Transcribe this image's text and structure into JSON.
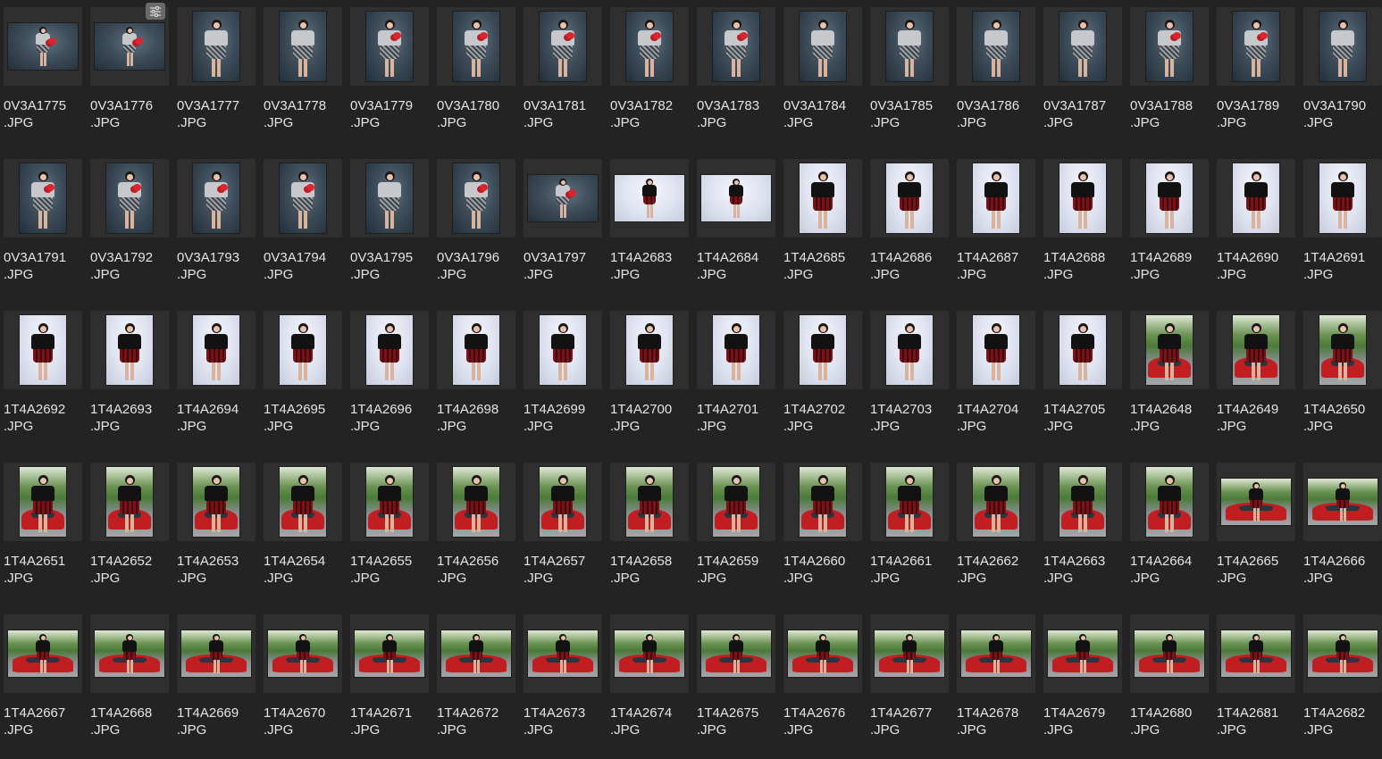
{
  "window": {
    "background": "#232323",
    "label_color": "#e4e4e4"
  },
  "badge": {
    "icon": "adjustments-sliders-icon"
  },
  "grid": {
    "columns": 16,
    "items": [
      {
        "name": "0V3A1775",
        "ext": ".JPG",
        "orient": "landscape",
        "scene": "studio-dark",
        "outfit": "grey-sequin",
        "prop": true
      },
      {
        "name": "0V3A1776",
        "ext": ".JPG",
        "orient": "landscape",
        "scene": "studio-dark",
        "outfit": "grey-sequin",
        "prop": true,
        "edited": true
      },
      {
        "name": "0V3A1777",
        "ext": ".JPG",
        "orient": "portrait",
        "scene": "studio-dark",
        "outfit": "grey-sequin"
      },
      {
        "name": "0V3A1778",
        "ext": ".JPG",
        "orient": "portrait",
        "scene": "studio-dark",
        "outfit": "grey-sequin"
      },
      {
        "name": "0V3A1779",
        "ext": ".JPG",
        "orient": "portrait",
        "scene": "studio-dark",
        "outfit": "grey-sequin",
        "prop": true
      },
      {
        "name": "0V3A1780",
        "ext": ".JPG",
        "orient": "portrait",
        "scene": "studio-dark",
        "outfit": "grey-sequin",
        "prop": true
      },
      {
        "name": "0V3A1781",
        "ext": ".JPG",
        "orient": "portrait",
        "scene": "studio-dark",
        "outfit": "grey-sequin",
        "prop": true
      },
      {
        "name": "0V3A1782",
        "ext": ".JPG",
        "orient": "portrait",
        "scene": "studio-dark",
        "outfit": "grey-sequin",
        "prop": true
      },
      {
        "name": "0V3A1783",
        "ext": ".JPG",
        "orient": "portrait",
        "scene": "studio-dark",
        "outfit": "grey-sequin",
        "prop": true
      },
      {
        "name": "0V3A1784",
        "ext": ".JPG",
        "orient": "portrait",
        "scene": "studio-dark",
        "outfit": "grey-sequin"
      },
      {
        "name": "0V3A1785",
        "ext": ".JPG",
        "orient": "portrait",
        "scene": "studio-dark",
        "outfit": "grey-sequin"
      },
      {
        "name": "0V3A1786",
        "ext": ".JPG",
        "orient": "portrait",
        "scene": "studio-dark",
        "outfit": "grey-sequin"
      },
      {
        "name": "0V3A1787",
        "ext": ".JPG",
        "orient": "portrait",
        "scene": "studio-dark",
        "outfit": "grey-sequin"
      },
      {
        "name": "0V3A1788",
        "ext": ".JPG",
        "orient": "portrait",
        "scene": "studio-dark",
        "outfit": "grey-sequin",
        "prop": true
      },
      {
        "name": "0V3A1789",
        "ext": ".JPG",
        "orient": "portrait",
        "scene": "studio-dark",
        "outfit": "grey-sequin",
        "prop": true
      },
      {
        "name": "0V3A1790",
        "ext": ".JPG",
        "orient": "portrait",
        "scene": "studio-dark",
        "outfit": "grey-sequin"
      },
      {
        "name": "0V3A1791",
        "ext": ".JPG",
        "orient": "portrait",
        "scene": "studio-dark",
        "outfit": "grey-sequin",
        "prop": true
      },
      {
        "name": "0V3A1792",
        "ext": ".JPG",
        "orient": "portrait",
        "scene": "studio-dark",
        "outfit": "grey-sequin",
        "prop": true
      },
      {
        "name": "0V3A1793",
        "ext": ".JPG",
        "orient": "portrait",
        "scene": "studio-dark",
        "outfit": "grey-sequin",
        "prop": true
      },
      {
        "name": "0V3A1794",
        "ext": ".JPG",
        "orient": "portrait",
        "scene": "studio-dark",
        "outfit": "grey-sequin",
        "prop": true
      },
      {
        "name": "0V3A1795",
        "ext": ".JPG",
        "orient": "portrait",
        "scene": "studio-dark",
        "outfit": "grey-sequin"
      },
      {
        "name": "0V3A1796",
        "ext": ".JPG",
        "orient": "portrait",
        "scene": "studio-dark",
        "outfit": "grey-sequin",
        "prop": true
      },
      {
        "name": "0V3A1797",
        "ext": ".JPG",
        "orient": "landscape",
        "scene": "studio-dark",
        "outfit": "grey-sequin",
        "prop": true
      },
      {
        "name": "1T4A2683",
        "ext": ".JPG",
        "orient": "landscape",
        "scene": "studio-light",
        "outfit": "black-plaid"
      },
      {
        "name": "1T4A2684",
        "ext": ".JPG",
        "orient": "landscape",
        "scene": "studio-light",
        "outfit": "black-plaid"
      },
      {
        "name": "1T4A2685",
        "ext": ".JPG",
        "orient": "portrait",
        "scene": "studio-light",
        "outfit": "black-plaid"
      },
      {
        "name": "1T4A2686",
        "ext": ".JPG",
        "orient": "portrait",
        "scene": "studio-light",
        "outfit": "black-plaid"
      },
      {
        "name": "1T4A2687",
        "ext": ".JPG",
        "orient": "portrait",
        "scene": "studio-light",
        "outfit": "black-plaid"
      },
      {
        "name": "1T4A2688",
        "ext": ".JPG",
        "orient": "portrait",
        "scene": "studio-light",
        "outfit": "black-plaid"
      },
      {
        "name": "1T4A2689",
        "ext": ".JPG",
        "orient": "portrait",
        "scene": "studio-light",
        "outfit": "black-plaid"
      },
      {
        "name": "1T4A2690",
        "ext": ".JPG",
        "orient": "portrait",
        "scene": "studio-light",
        "outfit": "black-plaid"
      },
      {
        "name": "1T4A2691",
        "ext": ".JPG",
        "orient": "portrait",
        "scene": "studio-light",
        "outfit": "black-plaid"
      },
      {
        "name": "1T4A2692",
        "ext": ".JPG",
        "orient": "portrait",
        "scene": "studio-light",
        "outfit": "black-plaid"
      },
      {
        "name": "1T4A2693",
        "ext": ".JPG",
        "orient": "portrait",
        "scene": "studio-light",
        "outfit": "black-plaid"
      },
      {
        "name": "1T4A2694",
        "ext": ".JPG",
        "orient": "portrait",
        "scene": "studio-light",
        "outfit": "black-plaid"
      },
      {
        "name": "1T4A2695",
        "ext": ".JPG",
        "orient": "portrait",
        "scene": "studio-light",
        "outfit": "black-plaid"
      },
      {
        "name": "1T4A2696",
        "ext": ".JPG",
        "orient": "portrait",
        "scene": "studio-light",
        "outfit": "black-plaid"
      },
      {
        "name": "1T4A2698",
        "ext": ".JPG",
        "orient": "portrait",
        "scene": "studio-light",
        "outfit": "black-plaid"
      },
      {
        "name": "1T4A2699",
        "ext": ".JPG",
        "orient": "portrait",
        "scene": "studio-light",
        "outfit": "black-plaid"
      },
      {
        "name": "1T4A2700",
        "ext": ".JPG",
        "orient": "portrait",
        "scene": "studio-light",
        "outfit": "black-plaid"
      },
      {
        "name": "1T4A2701",
        "ext": ".JPG",
        "orient": "portrait",
        "scene": "studio-light",
        "outfit": "black-plaid"
      },
      {
        "name": "1T4A2702",
        "ext": ".JPG",
        "orient": "portrait",
        "scene": "studio-light",
        "outfit": "black-plaid"
      },
      {
        "name": "1T4A2703",
        "ext": ".JPG",
        "orient": "portrait",
        "scene": "studio-light",
        "outfit": "black-plaid"
      },
      {
        "name": "1T4A2704",
        "ext": ".JPG",
        "orient": "portrait",
        "scene": "studio-light",
        "outfit": "black-plaid"
      },
      {
        "name": "1T4A2705",
        "ext": ".JPG",
        "orient": "portrait",
        "scene": "studio-light",
        "outfit": "black-plaid"
      },
      {
        "name": "1T4A2648",
        "ext": ".JPG",
        "orient": "portrait",
        "scene": "car-outdoor",
        "outfit": "black-plaid"
      },
      {
        "name": "1T4A2649",
        "ext": ".JPG",
        "orient": "portrait",
        "scene": "car-outdoor",
        "outfit": "black-plaid"
      },
      {
        "name": "1T4A2650",
        "ext": ".JPG",
        "orient": "portrait",
        "scene": "car-outdoor",
        "outfit": "black-plaid"
      },
      {
        "name": "1T4A2651",
        "ext": ".JPG",
        "orient": "portrait",
        "scene": "car-outdoor",
        "outfit": "black-plaid"
      },
      {
        "name": "1T4A2652",
        "ext": ".JPG",
        "orient": "portrait",
        "scene": "car-outdoor",
        "outfit": "black-plaid"
      },
      {
        "name": "1T4A2653",
        "ext": ".JPG",
        "orient": "portrait",
        "scene": "car-outdoor",
        "outfit": "black-plaid"
      },
      {
        "name": "1T4A2654",
        "ext": ".JPG",
        "orient": "portrait",
        "scene": "car-outdoor",
        "outfit": "black-plaid"
      },
      {
        "name": "1T4A2655",
        "ext": ".JPG",
        "orient": "portrait",
        "scene": "car-outdoor",
        "outfit": "black-plaid"
      },
      {
        "name": "1T4A2656",
        "ext": ".JPG",
        "orient": "portrait",
        "scene": "car-outdoor",
        "outfit": "black-plaid"
      },
      {
        "name": "1T4A2657",
        "ext": ".JPG",
        "orient": "portrait",
        "scene": "car-outdoor",
        "outfit": "black-plaid"
      },
      {
        "name": "1T4A2658",
        "ext": ".JPG",
        "orient": "portrait",
        "scene": "car-outdoor",
        "outfit": "black-plaid"
      },
      {
        "name": "1T4A2659",
        "ext": ".JPG",
        "orient": "portrait",
        "scene": "car-outdoor",
        "outfit": "black-plaid"
      },
      {
        "name": "1T4A2660",
        "ext": ".JPG",
        "orient": "portrait",
        "scene": "car-outdoor",
        "outfit": "black-plaid"
      },
      {
        "name": "1T4A2661",
        "ext": ".JPG",
        "orient": "portrait",
        "scene": "car-outdoor",
        "outfit": "black-plaid"
      },
      {
        "name": "1T4A2662",
        "ext": ".JPG",
        "orient": "portrait",
        "scene": "car-outdoor",
        "outfit": "black-plaid"
      },
      {
        "name": "1T4A2663",
        "ext": ".JPG",
        "orient": "portrait",
        "scene": "car-outdoor",
        "outfit": "black-plaid"
      },
      {
        "name": "1T4A2664",
        "ext": ".JPG",
        "orient": "portrait",
        "scene": "car-outdoor",
        "outfit": "black-plaid"
      },
      {
        "name": "1T4A2665",
        "ext": ".JPG",
        "orient": "landscape",
        "scene": "car-outdoor",
        "outfit": "black-plaid"
      },
      {
        "name": "1T4A2666",
        "ext": ".JPG",
        "orient": "landscape",
        "scene": "car-outdoor",
        "outfit": "black-plaid"
      },
      {
        "name": "1T4A2667",
        "ext": ".JPG",
        "orient": "landscape",
        "scene": "car-outdoor",
        "outfit": "black-plaid"
      },
      {
        "name": "1T4A2668",
        "ext": ".JPG",
        "orient": "landscape",
        "scene": "car-outdoor",
        "outfit": "black-plaid"
      },
      {
        "name": "1T4A2669",
        "ext": ".JPG",
        "orient": "landscape",
        "scene": "car-outdoor",
        "outfit": "black-plaid"
      },
      {
        "name": "1T4A2670",
        "ext": ".JPG",
        "orient": "landscape",
        "scene": "car-outdoor",
        "outfit": "black-plaid"
      },
      {
        "name": "1T4A2671",
        "ext": ".JPG",
        "orient": "landscape",
        "scene": "car-outdoor",
        "outfit": "black-plaid"
      },
      {
        "name": "1T4A2672",
        "ext": ".JPG",
        "orient": "landscape",
        "scene": "car-outdoor",
        "outfit": "black-plaid"
      },
      {
        "name": "1T4A2673",
        "ext": ".JPG",
        "orient": "landscape",
        "scene": "car-outdoor",
        "outfit": "black-plaid"
      },
      {
        "name": "1T4A2674",
        "ext": ".JPG",
        "orient": "landscape",
        "scene": "car-outdoor",
        "outfit": "black-plaid"
      },
      {
        "name": "1T4A2675",
        "ext": ".JPG",
        "orient": "landscape",
        "scene": "car-outdoor",
        "outfit": "black-plaid"
      },
      {
        "name": "1T4A2676",
        "ext": ".JPG",
        "orient": "landscape",
        "scene": "car-outdoor",
        "outfit": "black-plaid"
      },
      {
        "name": "1T4A2677",
        "ext": ".JPG",
        "orient": "landscape",
        "scene": "car-outdoor",
        "outfit": "black-plaid"
      },
      {
        "name": "1T4A2678",
        "ext": ".JPG",
        "orient": "landscape",
        "scene": "car-outdoor",
        "outfit": "black-plaid"
      },
      {
        "name": "1T4A2679",
        "ext": ".JPG",
        "orient": "landscape",
        "scene": "car-outdoor",
        "outfit": "black-plaid"
      },
      {
        "name": "1T4A2680",
        "ext": ".JPG",
        "orient": "landscape",
        "scene": "car-outdoor",
        "outfit": "black-plaid"
      },
      {
        "name": "1T4A2681",
        "ext": ".JPG",
        "orient": "landscape",
        "scene": "car-outdoor",
        "outfit": "black-plaid"
      },
      {
        "name": "1T4A2682",
        "ext": ".JPG",
        "orient": "landscape",
        "scene": "car-outdoor",
        "outfit": "black-plaid"
      }
    ]
  }
}
